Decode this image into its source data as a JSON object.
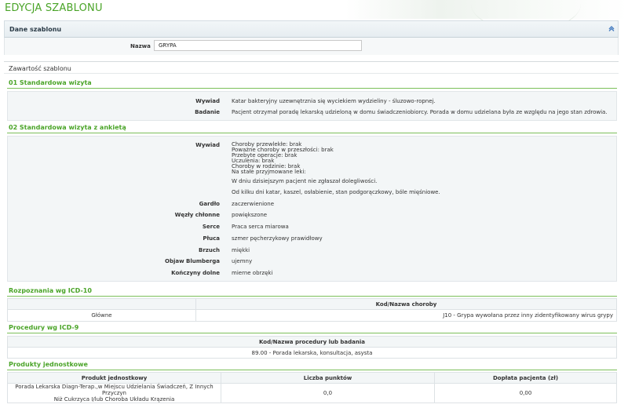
{
  "page": {
    "title": "EDYCJA SZABLONU"
  },
  "dane_szablonu": {
    "header": "Dane szablonu",
    "nazwa_label": "Nazwa",
    "nazwa_value": "GRYPA"
  },
  "zawartosc": {
    "header": "Zawartość szablonu"
  },
  "wizyta1": {
    "title": "01 Standardowa wizyta",
    "rows": [
      {
        "label": "Wywiad",
        "value": "Katar bakteryjny uzewnętrznia się wyciekiem wydzieliny - śluzowo-ropnej."
      },
      {
        "label": "Badanie",
        "value": "Pacjent otrzymał poradę lekarską udzieloną w domu świadczeniobiorcy. Porada w domu udzielana była ze względu na jego stan zdrowia."
      }
    ]
  },
  "wizyta2": {
    "title": "02 Standardowa wizyta z ankietą",
    "wywiad_label": "Wywiad",
    "wywiad_lines": [
      "Choroby przewlekłe: brak",
      "Poważne choroby w przeszłości: brak",
      "Przebyte operacje: brak",
      "Uczulenia: brak",
      "Choroby w rodzinie: brak",
      "Na stałe przyjmowane leki:"
    ],
    "wywiad_p2": "W dniu dzisiejszym pacjent nie zgłaszał dolegliwości.",
    "wywiad_p3": "Od kilku dni katar, kaszel, osłabienie, stan podgorączkowy, bóle mięśniowe.",
    "rows": [
      {
        "label": "Gardło",
        "value": "zaczerwienione"
      },
      {
        "label": "Węzły chłonne",
        "value": "powiększone"
      },
      {
        "label": "Serce",
        "value": "Praca serca miarowa"
      },
      {
        "label": "Płuca",
        "value": "szmer pęcherzykowy prawidłowy"
      },
      {
        "label": "Brzuch",
        "value": "miękki"
      },
      {
        "label": "Objaw Blumberga",
        "value": "ujemny"
      },
      {
        "label": "Kończyny dolne",
        "value": "mierne obrzęki"
      }
    ]
  },
  "icd10": {
    "title": "Rozpoznania wg ICD-10",
    "col_header": "Kod/Nazwa choroby",
    "row_type": "Główne",
    "row_value": "J10 - Grypa wywołana przez inny zidentyfikowany wirus grypy"
  },
  "icd9": {
    "title": "Procedury wg ICD-9",
    "col_header": "Kod/Nazwa procedury lub badania",
    "row_value": "89.00 - Porada lekarska, konsultacja, asysta"
  },
  "produkty": {
    "title": "Produkty jednostkowe",
    "headers": [
      "Produkt jednostkowy",
      "Liczba punktów",
      "Dopłata pacjenta (zł)"
    ],
    "row_line1": "Porada Lekarska Diagn-Terap.,w Miejscu Udzielania Świadczeń, Z Innych Przyczyn",
    "row_line2": "Niż Cukrzyca I/lub Choroba Układu Krązenia",
    "punkty": "0,0",
    "doplata": "0,00"
  }
}
